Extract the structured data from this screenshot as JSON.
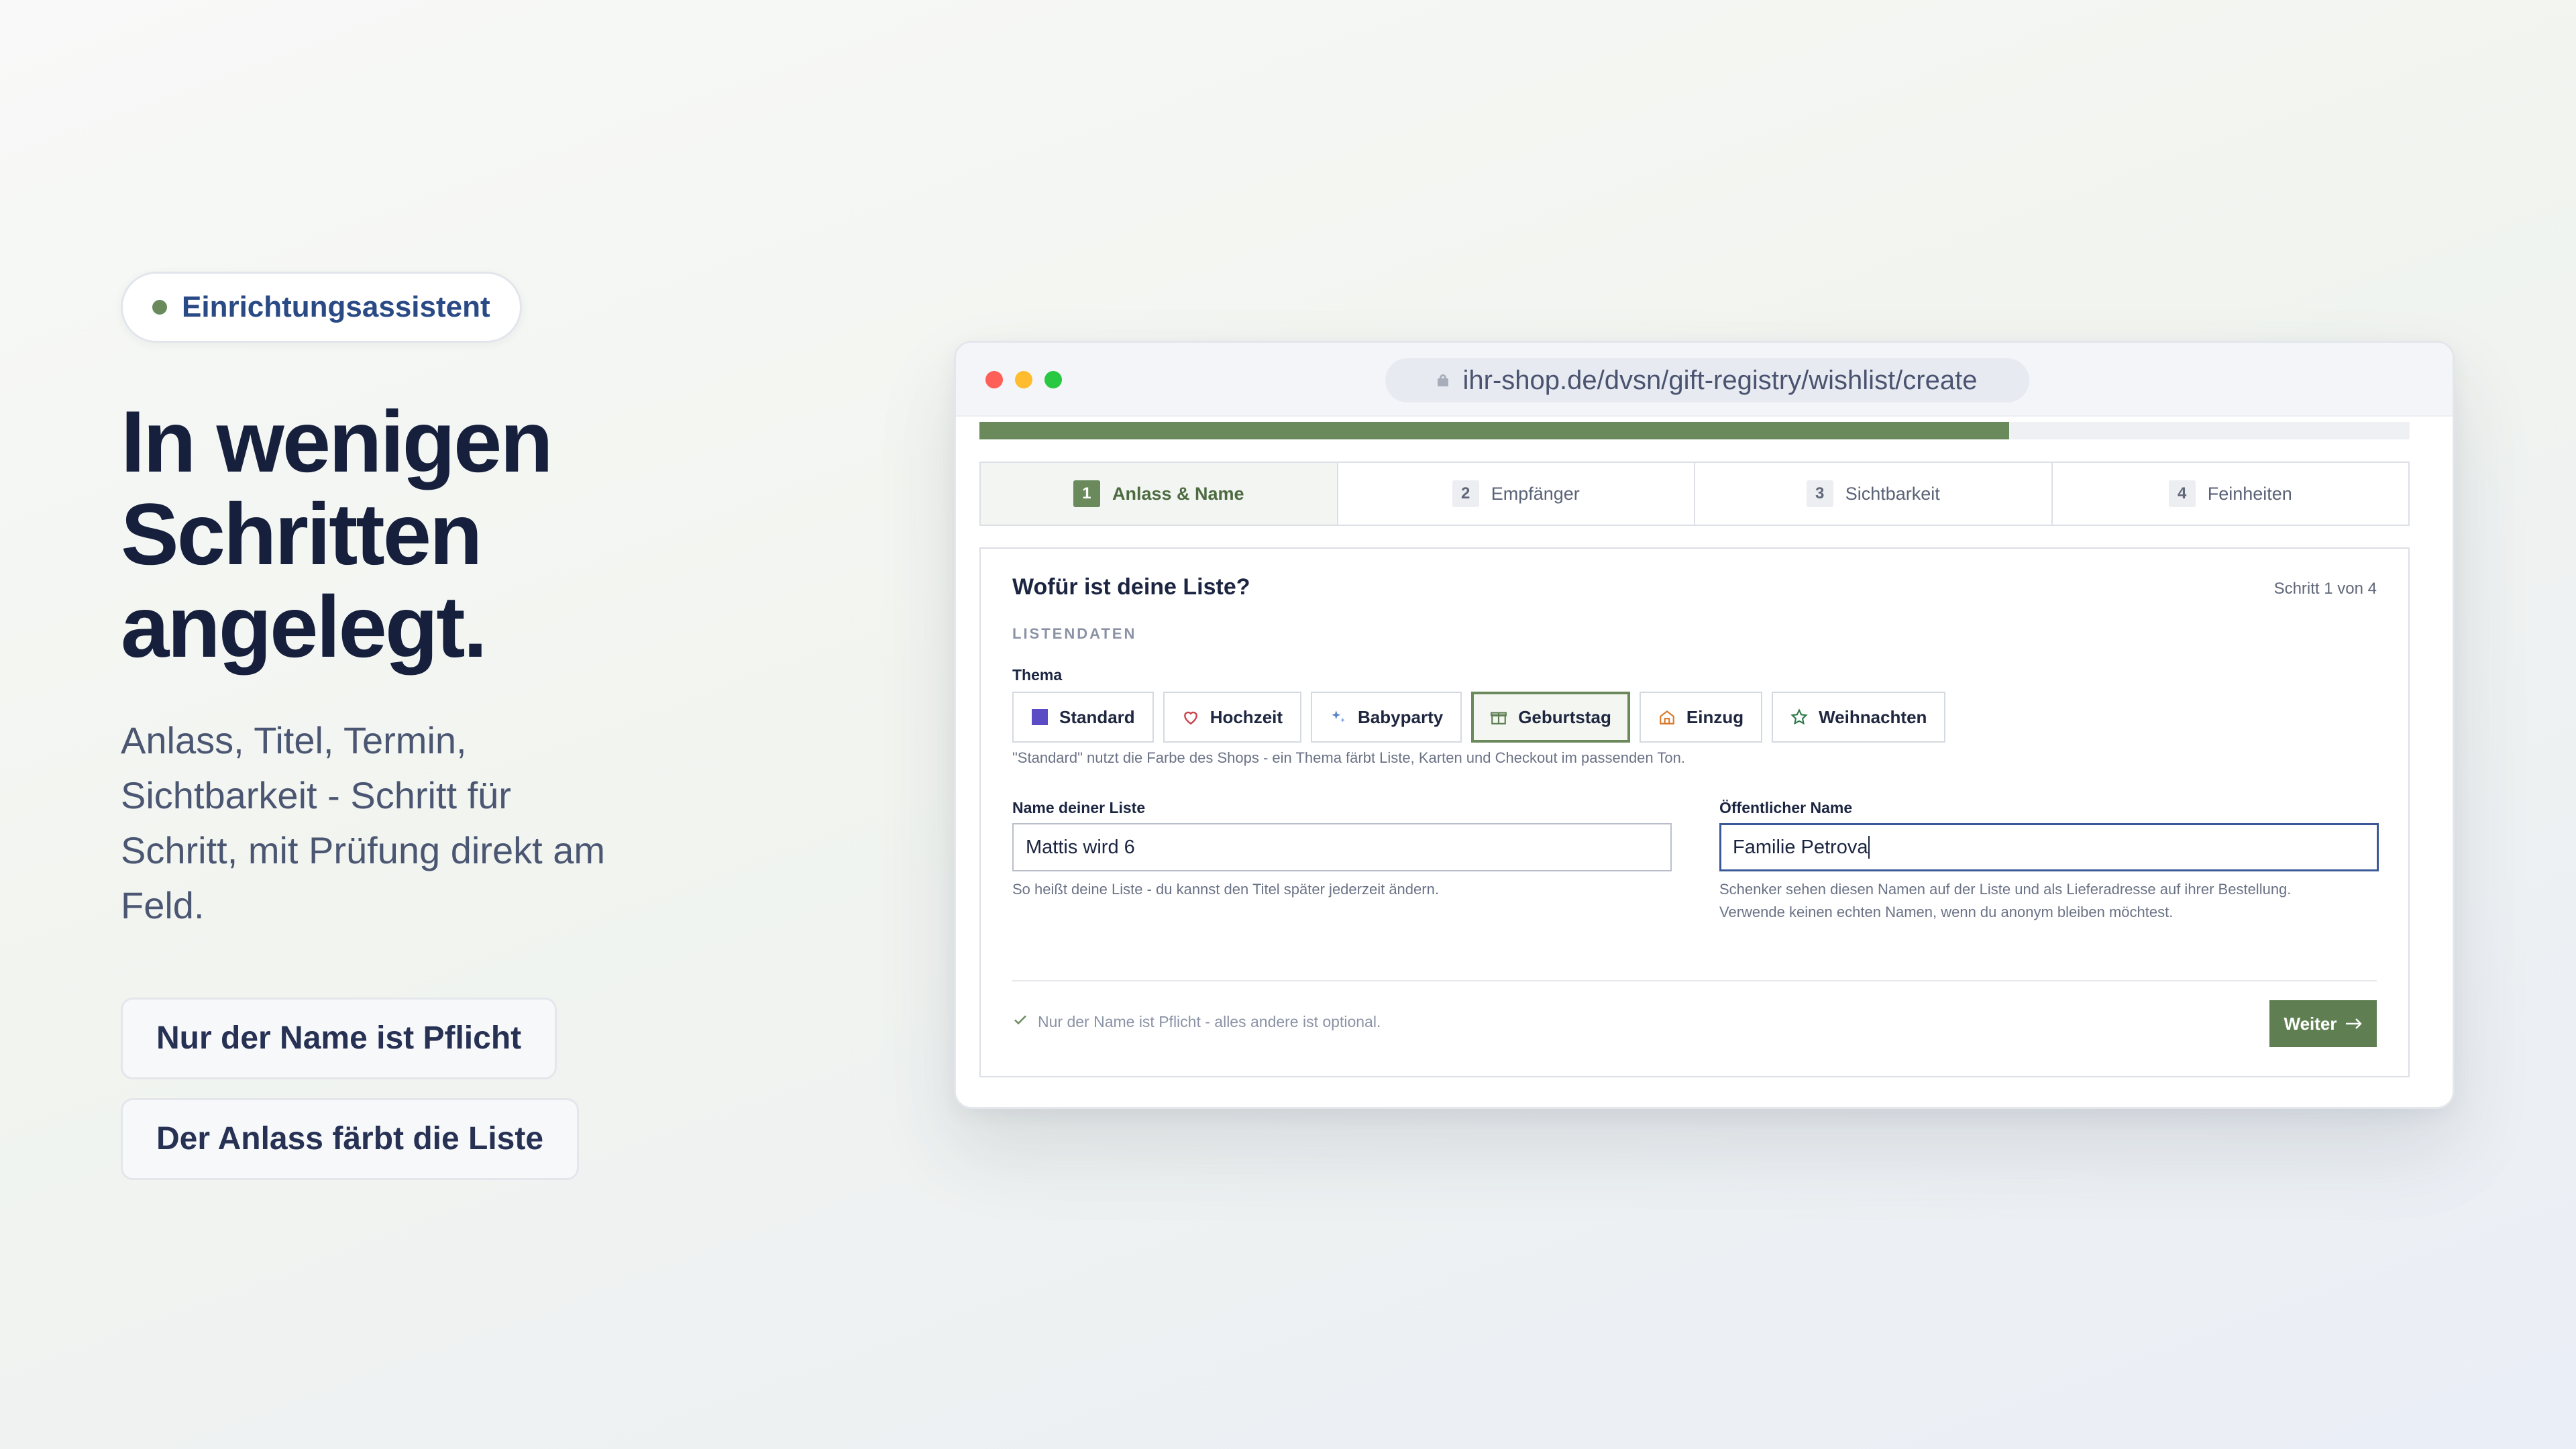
{
  "hero": {
    "badge": "Einrichtungsassistent",
    "headline": "In wenigen\nSchritten\nangelegt.",
    "subtitle": "Anlass, Titel, Termin, Sichtbarkeit - Schritt für Schritt, mit Prüfung direkt am Feld.",
    "chips": [
      "Nur der Name ist Pflicht",
      "Der Anlass färbt die Liste"
    ]
  },
  "browser": {
    "url": "ihr-shop.de/dvsn/gift-registry/wishlist/create"
  },
  "progress": {
    "fraction": 0.72
  },
  "steps": [
    {
      "num": "1",
      "label": "Anlass & Name",
      "active": true
    },
    {
      "num": "2",
      "label": "Empfänger",
      "active": false
    },
    {
      "num": "3",
      "label": "Sichtbarkeit",
      "active": false
    },
    {
      "num": "4",
      "label": "Feinheiten",
      "active": false
    }
  ],
  "form": {
    "title": "Wofür ist deine Liste?",
    "step_of": "Schritt 1 von 4",
    "section": "LISTENDATEN",
    "theme_label": "Thema",
    "themes": [
      {
        "label": "Standard",
        "icon": "square-icon",
        "selected": false
      },
      {
        "label": "Hochzeit",
        "icon": "heart-icon",
        "selected": false
      },
      {
        "label": "Babyparty",
        "icon": "sparkle-icon",
        "selected": false
      },
      {
        "label": "Geburtstag",
        "icon": "gift-icon",
        "selected": true
      },
      {
        "label": "Einzug",
        "icon": "house-icon",
        "selected": false
      },
      {
        "label": "Weihnachten",
        "icon": "star-icon",
        "selected": false
      }
    ],
    "theme_help": "\"Standard\" nutzt die Farbe des Shops - ein Thema färbt Liste, Karten und Checkout im passenden Ton.",
    "name": {
      "label": "Name deiner Liste",
      "value": "Mattis wird 6",
      "help": "So heißt deine Liste - du kannst den Titel später jederzeit ändern."
    },
    "public_name": {
      "label": "Öffentlicher Name",
      "value": "Familie Petrova",
      "help_1": "Schenker sehen diesen Namen auf der Liste und als Lieferadresse auf ihrer Bestellung.",
      "help_2": "Verwende keinen echten Namen, wenn du anonym bleiben möchtest."
    },
    "footnote": "Nur der Name ist Pflicht - alles andere ist optional.",
    "next_button": "Weiter"
  },
  "colors": {
    "accent": "#6a8a5c",
    "button": "#5f7f52",
    "headline": "#16203c",
    "badge_text": "#2a4a86",
    "focus": "#3b5998"
  }
}
